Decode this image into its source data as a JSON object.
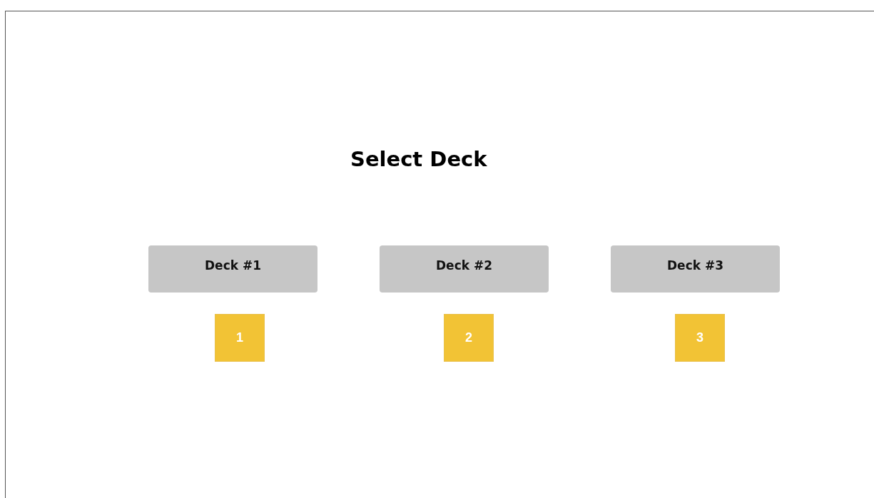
{
  "title": "Select Deck",
  "decks": [
    {
      "label": "Deck #1",
      "number": "1"
    },
    {
      "label": "Deck #2",
      "number": "2"
    },
    {
      "label": "Deck #3",
      "number": "3"
    }
  ]
}
